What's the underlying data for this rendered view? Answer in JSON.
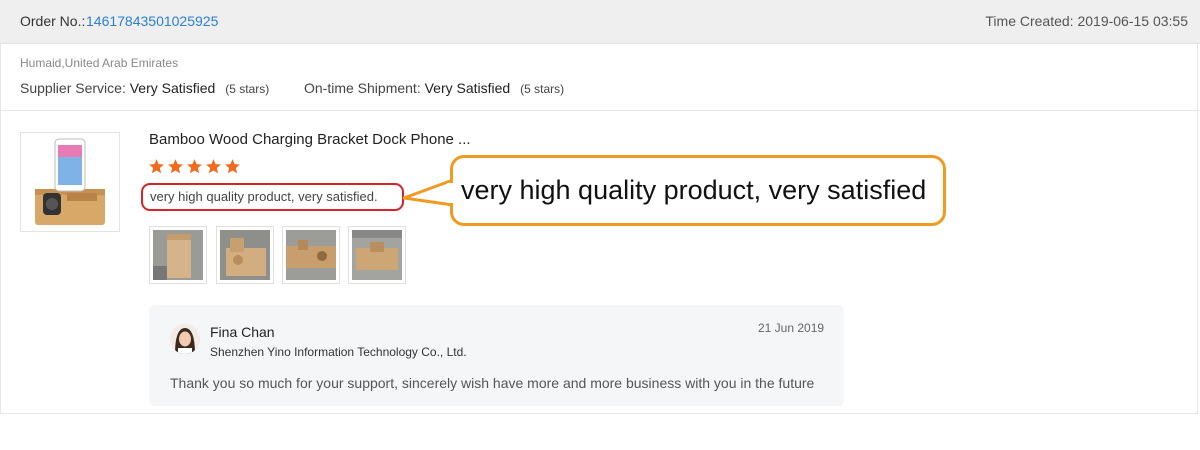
{
  "order": {
    "label": "Order No.:",
    "number": "14617843501025925",
    "time_created": "Time Created: 2019-06-15 03:55"
  },
  "buyer": {
    "location": "Humaid,United Arab Emirates",
    "supplier_service": {
      "label": "Supplier Service:",
      "value": "Very Satisfied",
      "stars": "(5 stars)"
    },
    "on_time_shipment": {
      "label": "On-time Shipment:",
      "value": "Very Satisfied",
      "stars": "(5 stars)"
    }
  },
  "review": {
    "product_title": "Bamboo Wood Charging Bracket Dock Phone ...",
    "rating": 5,
    "text": "very high quality product, very satisfied.",
    "callout": "very high quality product, very satisfied",
    "photos": [
      "photo-1",
      "photo-2",
      "photo-3",
      "photo-4"
    ]
  },
  "reply": {
    "name": "Fina Chan",
    "company": "Shenzhen Yino Information Technology Co., Ltd.",
    "date": "21 Jun 2019",
    "text": "Thank you so much for your support,  sincerely wish have more and more business with you in the future"
  },
  "colors": {
    "link": "#2a7fd4",
    "star": "#f26a1b",
    "highlight_border": "#d8232a",
    "callout_border": "#f19a21"
  }
}
